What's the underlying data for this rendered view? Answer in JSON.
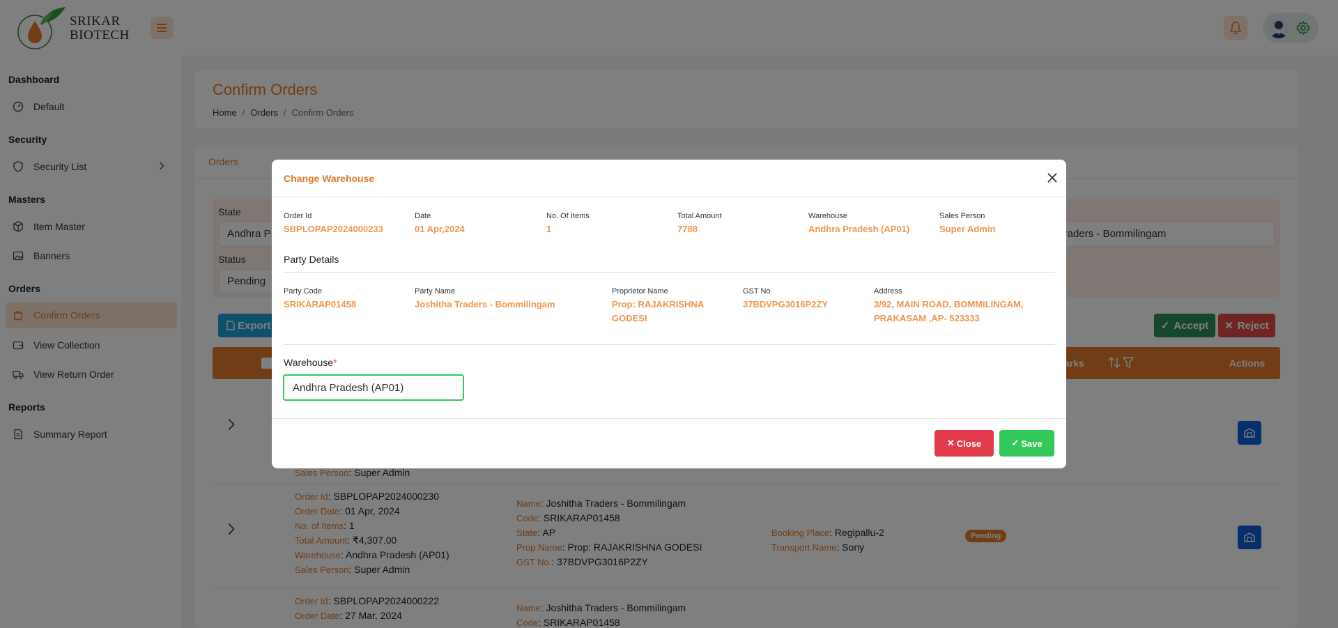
{
  "brand": {
    "line1": "SRIKAR",
    "line2": "BIOTECH"
  },
  "sidebar": {
    "sections": [
      {
        "title": "Dashboard",
        "items": [
          {
            "label": "Default",
            "icon": "gauge-icon"
          }
        ]
      },
      {
        "title": "Security",
        "items": [
          {
            "label": "Security List",
            "icon": "shield-icon"
          }
        ]
      },
      {
        "title": "Masters",
        "items": [
          {
            "label": "Item Master",
            "icon": "box-icon"
          },
          {
            "label": "Banners",
            "icon": "image-icon"
          }
        ]
      },
      {
        "title": "Orders",
        "items": [
          {
            "label": "Confirm Orders",
            "icon": "bag-icon"
          },
          {
            "label": "View Collection",
            "icon": "wallet-icon"
          },
          {
            "label": "View Return Order",
            "icon": "truck-icon"
          }
        ]
      },
      {
        "title": "Reports",
        "items": [
          {
            "label": "Summary Report",
            "icon": "report-icon"
          }
        ]
      }
    ]
  },
  "page": {
    "title": "Confirm Orders",
    "breadcrumb": [
      "Home",
      "Orders",
      "Confirm Orders"
    ],
    "tab": "Orders"
  },
  "filters": {
    "state_label": "State",
    "state_value": "Andhra P",
    "status_label": "Status",
    "status_value": "Pending",
    "party_value": "Traders - Bommilingam"
  },
  "actions": {
    "export": "Export",
    "accept": "Accept",
    "reject": "Reject"
  },
  "table": {
    "remarks_header": "arks",
    "actions_header": "Actions",
    "rows": [
      {
        "sales_person_key": "Sales Person",
        "sales_person": "Super Admin"
      },
      {
        "order_id_key": "Order Id",
        "order_id": "SBPLOPAP2024000230",
        "order_date_key": "Order Date",
        "order_date": "01 Apr, 2024",
        "items_key": "No. of Items",
        "items": "1",
        "amount_key": "Total Amount",
        "amount": "₹4,307.00",
        "warehouse_key": "Warehouse",
        "warehouse": "Andhra Pradesh (AP01)",
        "sales_person_key": "Sales Person",
        "sales_person": "Super Admin",
        "name_key": "Name",
        "name": "Joshitha Traders - Bommilingam",
        "code_key": "Code",
        "code": "SRIKARAP01458",
        "state_key": "State",
        "state": "AP",
        "prop_key": "Prop Name",
        "prop": "Prop: RAJAKRISHNA GODESI",
        "gst_key": "GST No.",
        "gst": "37BDVPG3016P2ZY",
        "booking_key": "Booking Place",
        "booking": "Regipallu-2",
        "transport_key": "Transport Name",
        "transport": "Sony",
        "status": "Pending"
      },
      {
        "order_id_key": "Order Id",
        "order_id": "SBPLOPAP2024000222",
        "order_date_key": "Order Date",
        "order_date": "27 Mar, 2024",
        "name_key": "Name",
        "name": "Joshitha Traders - Bommilingam",
        "code_key": "Code",
        "code": "SRIKARAP01458"
      }
    ]
  },
  "modal": {
    "title": "Change Warehouse",
    "summary": [
      {
        "label": "Order Id",
        "value": "SBPLOPAP2024000233"
      },
      {
        "label": "Date",
        "value": "01 Apr,2024"
      },
      {
        "label": "No. Of Items",
        "value": "1"
      },
      {
        "label": "Total Amount",
        "value": "7788"
      },
      {
        "label": "Warehouse",
        "value": "Andhra Pradesh (AP01)"
      },
      {
        "label": "Sales Person",
        "value": "Super Admin"
      }
    ],
    "party_section": "Party Details",
    "party": [
      {
        "label": "Party Code",
        "value": "SRIKARAP01458"
      },
      {
        "label": "Party Name",
        "value": "Joshitha Traders - Bommilingam"
      },
      {
        "label": "Proprietor Name",
        "value": "Prop: RAJAKRISHNA GODESI"
      },
      {
        "label": "GST No",
        "value": "37BDVPG3016P2ZY"
      },
      {
        "label": "Address",
        "value": "3/92, MAIN ROAD, BOMMILINGAM, PRAKASAM ,AP- 523333"
      }
    ],
    "warehouse_label": "Warehouse",
    "required_mark": "*",
    "warehouse_value": "Andhra Pradesh (AP01)",
    "close_label": "Close",
    "save_label": "Save"
  },
  "colors": {
    "accent": "#e07a2c",
    "success": "#34c759",
    "danger": "#e13a4a",
    "primary": "#0d5ed6"
  }
}
